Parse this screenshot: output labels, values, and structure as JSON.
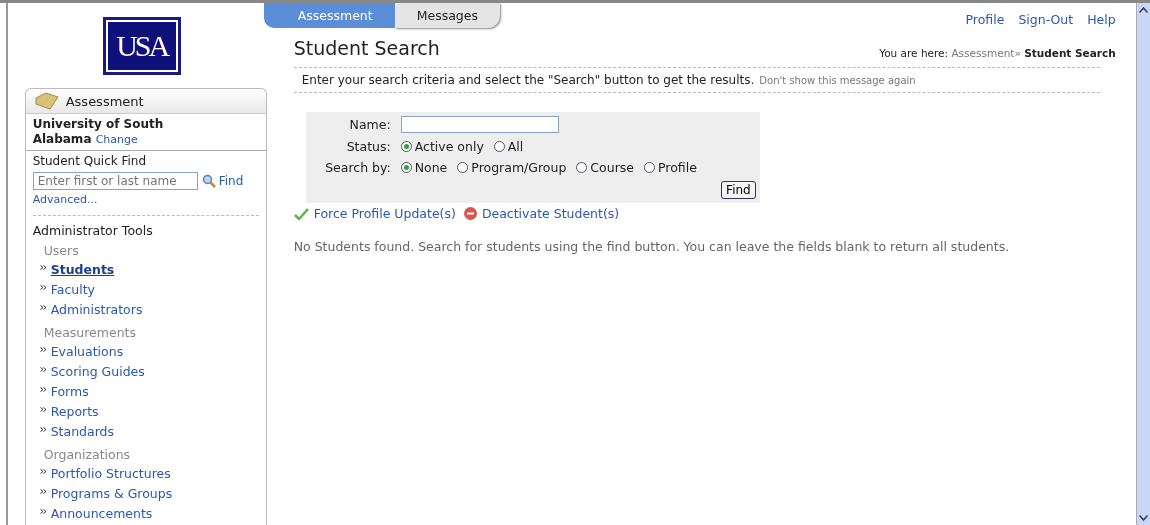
{
  "logo": {
    "text": "USA"
  },
  "tabs": [
    {
      "label": "Assessment",
      "selected": true
    },
    {
      "label": "Messages",
      "selected": false
    }
  ],
  "top_links": [
    "Profile",
    "Sign-Out",
    "Help"
  ],
  "sidebar": {
    "header": "Assessment",
    "institution": "University of South Alabama",
    "change_link": "Change",
    "quick_find": {
      "title": "Student Quick Find",
      "placeholder": "Enter first or last name",
      "find": "Find",
      "advanced": "Advanced..."
    },
    "tools_title": "Administrator Tools",
    "groups": [
      {
        "title": "Users",
        "items": [
          {
            "label": "Students",
            "selected": true
          },
          {
            "label": "Faculty",
            "selected": false
          },
          {
            "label": "Administrators",
            "selected": false
          }
        ]
      },
      {
        "title": "Measurements",
        "items": [
          {
            "label": "Evaluations",
            "selected": false
          },
          {
            "label": "Scoring Guides",
            "selected": false
          },
          {
            "label": "Forms",
            "selected": false
          },
          {
            "label": "Reports",
            "selected": false
          },
          {
            "label": "Standards",
            "selected": false
          }
        ]
      },
      {
        "title": "Organizations",
        "items": [
          {
            "label": "Portfolio Structures",
            "selected": false
          },
          {
            "label": "Programs & Groups",
            "selected": false
          },
          {
            "label": "Announcements",
            "selected": false
          }
        ]
      }
    ]
  },
  "page_title": "Student Search",
  "breadcrumb": {
    "prefix": "You are here:",
    "parent": "Assessment»",
    "current": "Student Search"
  },
  "info": {
    "text": "Enter your search criteria and select the \"Search\" button to get the results.",
    "dismiss": "Don't show this message again"
  },
  "form": {
    "name_label": "Name:",
    "status": {
      "label": "Status:",
      "options": [
        {
          "label": "Active only",
          "selected": true
        },
        {
          "label": "All",
          "selected": false
        }
      ]
    },
    "search_by": {
      "label": "Search by:",
      "options": [
        {
          "label": "None",
          "selected": true
        },
        {
          "label": "Program/Group",
          "selected": false
        },
        {
          "label": "Course",
          "selected": false
        },
        {
          "label": "Profile",
          "selected": false
        }
      ]
    },
    "find_button": "Find"
  },
  "actions": [
    {
      "kind": "check",
      "label": "Force Profile Update(s)"
    },
    {
      "kind": "remove",
      "label": "Deactivate Student(s)"
    }
  ],
  "result_message": "No Students found. Search for students using the find button. You can leave the fields blank to return all students."
}
